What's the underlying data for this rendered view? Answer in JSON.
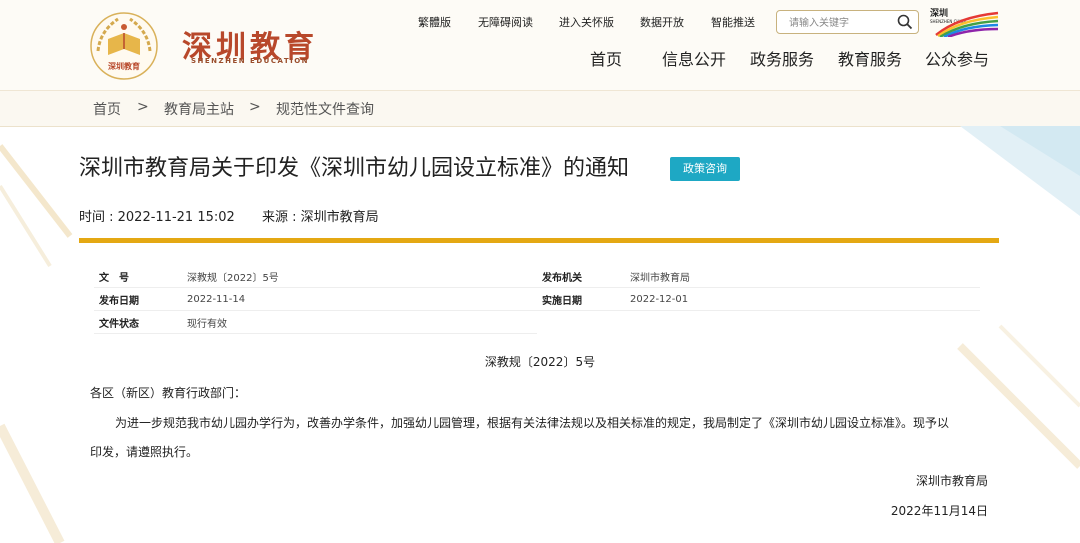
{
  "logo": {
    "cn": "深圳教育",
    "en": "SHENZHEN EDUCATION",
    "emblem_text": "深圳教育"
  },
  "top_links": [
    "繁體版",
    "无障碍阅读",
    "进入关怀版",
    "数据开放",
    "智能推送"
  ],
  "search": {
    "placeholder": "请输入关键字"
  },
  "brand_right": {
    "cn": "深圳",
    "en": "SHENZHEN CHINA"
  },
  "nav": [
    "首页",
    "信息公开",
    "政务服务",
    "教育服务",
    "公众参与"
  ],
  "breadcrumb": {
    "items": [
      "首页",
      "教育局主站",
      "规范性文件查询"
    ],
    "separator": ">"
  },
  "article": {
    "title": "深圳市教育局关于印发《深圳市幼儿园设立标准》的通知",
    "badge": "政策咨询",
    "time": "时间 : 2022-11-21 15:02",
    "source": "来源 : 深圳市教育局"
  },
  "info_table": [
    [
      "文　号",
      "深教规〔2022〕5号",
      "发布机关",
      "深圳市教育局"
    ],
    [
      "发布日期",
      "2022-11-14",
      "实施日期",
      "2022-12-01"
    ],
    [
      "文件状态",
      "现行有效",
      "",
      ""
    ]
  ],
  "body": {
    "doc_number": "深教规〔2022〕5号",
    "salutation": "各区（新区）教育行政部门：",
    "para_line1": "为进一步规范我市幼儿园办学行为，改善办学条件，加强幼儿园管理，根据有关法律法规以及相关标准的规定，我局制定了《深圳市幼儿园设立标准》。现予以",
    "para_line2": "印发，请遵照执行。",
    "signature": "深圳市教育局",
    "date": "2022年11月14日"
  },
  "colors": {
    "accent_gold": "#e4a813",
    "badge": "#1ea8c4",
    "logo_red": "#b8482b"
  }
}
